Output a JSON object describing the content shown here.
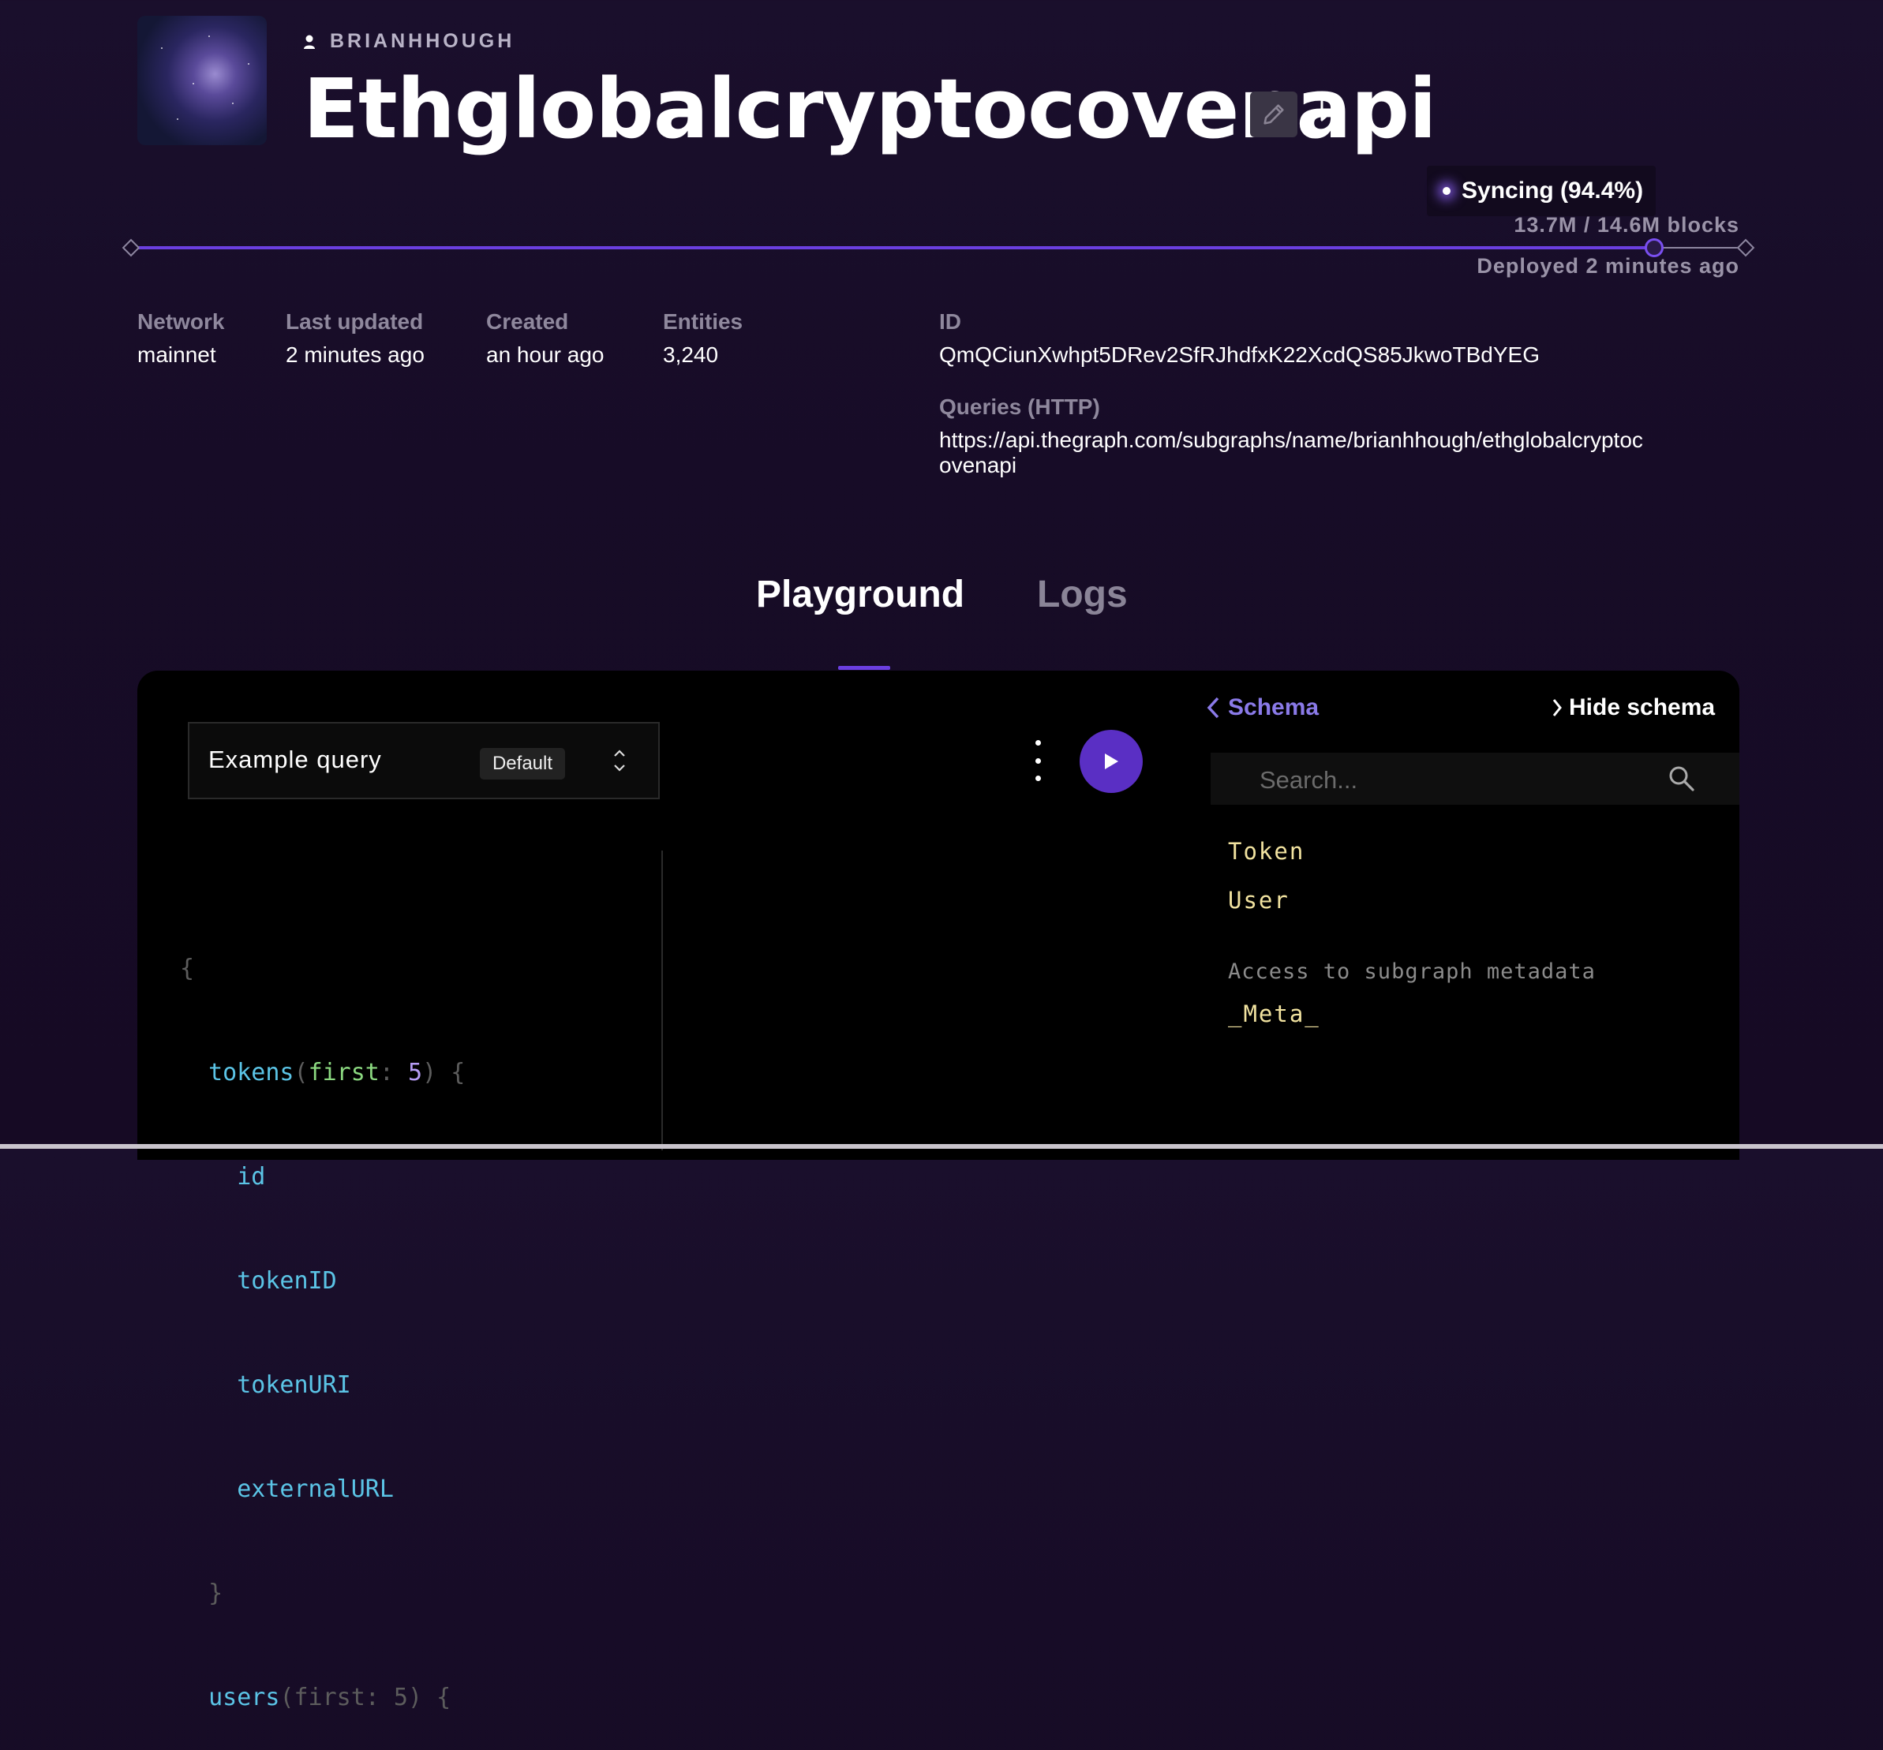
{
  "header": {
    "owner": "BRIANHHOUGH",
    "title": "Ethglobalcryptocovenapi"
  },
  "sync": {
    "status": "Syncing (94.4%)",
    "progress_fraction": 0.944,
    "blocks": "13.7M / 14.6M blocks",
    "deployed": "Deployed 2 minutes ago"
  },
  "meta": {
    "network_label": "Network",
    "network_value": "mainnet",
    "updated_label": "Last updated",
    "updated_value": "2 minutes ago",
    "created_label": "Created",
    "created_value": "an hour ago",
    "entities_label": "Entities",
    "entities_value": "3,240",
    "id_label": "ID",
    "id_value": "QmQCiunXwhpt5DRev2SfRJhdfxK22XcdQS85JkwoTBdYEG",
    "queries_label": "Queries (HTTP)",
    "queries_line1": "https://api.thegraph.com/subgraphs/name/brianhhough/ethglobalcryptoc",
    "queries_line2": "ovenapi"
  },
  "tabs": [
    {
      "label": "Playground",
      "active": true
    },
    {
      "label": "Logs",
      "active": false
    }
  ],
  "playground": {
    "query_name": "Example query",
    "query_badge": "Default",
    "code": {
      "open_brace": "{",
      "tokens_field": "tokens",
      "arg_open": "(",
      "arg_name": "first",
      "arg_colon": ":",
      "arg_value": "5",
      "arg_close": ")",
      "block_open": "{",
      "fields": [
        "id",
        "tokenID",
        "tokenURI",
        "externalURL"
      ],
      "block_close": "}",
      "users_field": "users",
      "users_tail": "(first: 5) {"
    }
  },
  "schema": {
    "back_label": "Schema",
    "hide_label": "Hide schema",
    "search_placeholder": "Search...",
    "types": [
      "Token",
      "User"
    ],
    "meta_description": "Access to subgraph metadata",
    "meta_type": "_Meta_"
  },
  "colors": {
    "accent": "#6b3fe0",
    "background": "#170c27",
    "schema_type": "#f2e3a0",
    "code_field": "#5bc4e6",
    "code_arg": "#8bd880",
    "code_number": "#b69cf5"
  },
  "icons": [
    "user-icon",
    "pencil-icon",
    "bookmark-icon",
    "chevron-left-icon",
    "chevron-right-icon",
    "search-icon",
    "play-icon",
    "kebab-menu-icon",
    "updown-chevron-icon"
  ]
}
